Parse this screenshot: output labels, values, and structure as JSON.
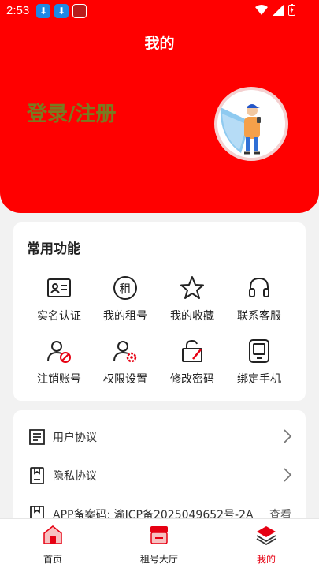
{
  "status_bar": {
    "time": "2:53"
  },
  "header": {
    "title": "我的",
    "login_text": "登录/注册"
  },
  "functions": {
    "title": "常用功能",
    "items": [
      {
        "label": "实名认证",
        "icon": "id-card-icon"
      },
      {
        "label": "我的租号",
        "icon": "rent-icon"
      },
      {
        "label": "我的收藏",
        "icon": "star-icon"
      },
      {
        "label": "联系客服",
        "icon": "headset-icon"
      },
      {
        "label": "注销账号",
        "icon": "user-cancel-icon"
      },
      {
        "label": "权限设置",
        "icon": "user-settings-icon"
      },
      {
        "label": "修改密码",
        "icon": "lock-edit-icon"
      },
      {
        "label": "绑定手机",
        "icon": "phone-icon"
      }
    ]
  },
  "list": {
    "items": [
      {
        "label": "用户协议",
        "icon": "document-icon"
      },
      {
        "label": "隐私协议",
        "icon": "privacy-icon"
      },
      {
        "label": "APP备案码: 渝ICP备2025049652号-2A",
        "icon": "filing-icon",
        "action": "查看"
      }
    ]
  },
  "tabbar": {
    "items": [
      {
        "label": "首页",
        "icon": "home-icon"
      },
      {
        "label": "租号大厅",
        "icon": "shop-icon"
      },
      {
        "label": "我的",
        "icon": "layers-icon",
        "active": true
      }
    ]
  },
  "colors": {
    "accent": "#ff0000",
    "login_text": "#7a7a20",
    "active_tab": "#e60012"
  }
}
